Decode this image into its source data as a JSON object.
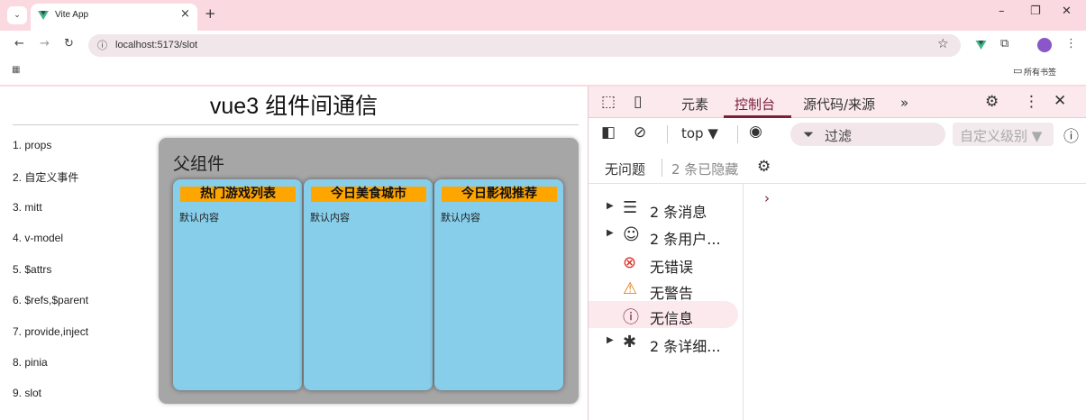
{
  "browser": {
    "tab_title": "Vite App",
    "tab_close": "×",
    "new_tab": "+",
    "url": "localhost:5173/slot",
    "bookmark_all": "所有书签",
    "colors": {
      "chrome_bg": "#fbd9e1",
      "vue_green": "#41b883"
    }
  },
  "page": {
    "title": "vue3 组件间通信",
    "nav": [
      "1. props",
      "2. 自定义事件",
      "3. mitt",
      "4. v-model",
      "5. $attrs",
      "6. $refs,$parent",
      "7. provide,inject",
      "8. pinia",
      "9. slot"
    ],
    "parent_title": "父组件",
    "cards": [
      {
        "title": "热门游戏列表",
        "body": "默认内容"
      },
      {
        "title": "今日美食城市",
        "body": "默认内容"
      },
      {
        "title": "今日影视推荐",
        "body": "默认内容"
      }
    ],
    "colors": {
      "parent_bg": "#a6a6a6",
      "card_bg": "#87ceeb",
      "card_head": "#ffa500"
    }
  },
  "devtools": {
    "tabs": [
      "元素",
      "控制台",
      "源代码/来源"
    ],
    "active_tab": "控制台",
    "more": "»",
    "context": "top ▼",
    "filter_label": "过滤",
    "level_label": "自定义级别 ▼",
    "issues": "无问题",
    "hidden": "2 条已隐藏",
    "sidebar": [
      {
        "icon": "list-icon",
        "label": "2 条消息",
        "expandable": true
      },
      {
        "icon": "user-icon",
        "label": "2 条用户...",
        "expandable": true
      },
      {
        "icon": "error-icon",
        "label": "无错误",
        "expandable": false
      },
      {
        "icon": "warning-icon",
        "label": "无警告",
        "expandable": false
      },
      {
        "icon": "info-icon",
        "label": "无信息",
        "expandable": false,
        "selected": true
      },
      {
        "icon": "bug-icon",
        "label": "2 条详细...",
        "expandable": true
      }
    ],
    "prompt": "›",
    "colors": {
      "accent": "#7b1f3a",
      "error": "#d93025",
      "warning": "#e37400"
    }
  }
}
